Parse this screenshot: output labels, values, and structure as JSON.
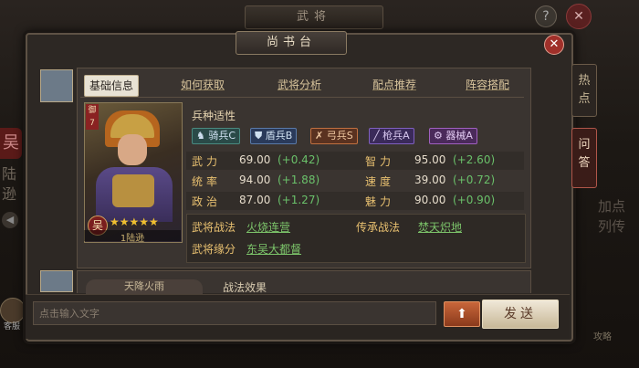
{
  "background": {
    "window_title": "武将",
    "help_icon": "?",
    "close_icon": "✕",
    "side_seal": "吴",
    "side_text": "陆逊",
    "avatar_label": "客服",
    "right_col_text": "加点列传",
    "right_bottom_text": "攻略"
  },
  "dialog": {
    "title": "尚书台",
    "close_icon": "✕"
  },
  "side_tabs": [
    {
      "label": "热点",
      "active": false
    },
    {
      "label": "问答",
      "active": true
    }
  ],
  "card": {
    "tabs": [
      {
        "label": "基础信息",
        "active": true
      },
      {
        "label": "如何获取",
        "active": false
      },
      {
        "label": "武将分析",
        "active": false
      },
      {
        "label": "配点推荐",
        "active": false
      },
      {
        "label": "阵容搭配",
        "active": false
      }
    ],
    "portrait": {
      "rank_tag": "御7",
      "faction": "吴",
      "stars": "★★★★★",
      "level": "1陆逊"
    },
    "troop_section_title": "兵种适性",
    "troops": [
      {
        "label": "骑兵C",
        "icon": "horse-icon",
        "color": "#2a4a48"
      },
      {
        "label": "盾兵B",
        "icon": "shield-icon",
        "color": "#2a3a5a"
      },
      {
        "label": "弓兵S",
        "icon": "bow-icon",
        "color": "#5a3220"
      },
      {
        "label": "枪兵A",
        "icon": "spear-icon",
        "color": "#3a2a5a"
      },
      {
        "label": "器械A",
        "icon": "gear-icon",
        "color": "#4a2a5a"
      }
    ],
    "stats": [
      {
        "label": "武力",
        "value": "69.00",
        "inc": "(+0.42)"
      },
      {
        "label": "智力",
        "value": "95.00",
        "inc": "(+2.60)"
      },
      {
        "label": "统率",
        "value": "94.00",
        "inc": "(+1.88)"
      },
      {
        "label": "速度",
        "value": "39.00",
        "inc": "(+0.72)"
      },
      {
        "label": "政治",
        "value": "87.00",
        "inc": "(+1.27)"
      },
      {
        "label": "魅力",
        "value": "90.00",
        "inc": "(+0.90)"
      }
    ],
    "skills": {
      "tactic_label": "武将战法",
      "tactic_value": "火烧连营",
      "inherit_label": "传承战法",
      "inherit_value": "焚天炽地",
      "bond_label": "武将缘分",
      "bond_value": "东吴大都督"
    }
  },
  "card2": {
    "button": "天降火雨",
    "text": "战法效果"
  },
  "input_bar": {
    "placeholder": "点击输入文字",
    "up_icon": "⬆",
    "send_label": "发送"
  }
}
